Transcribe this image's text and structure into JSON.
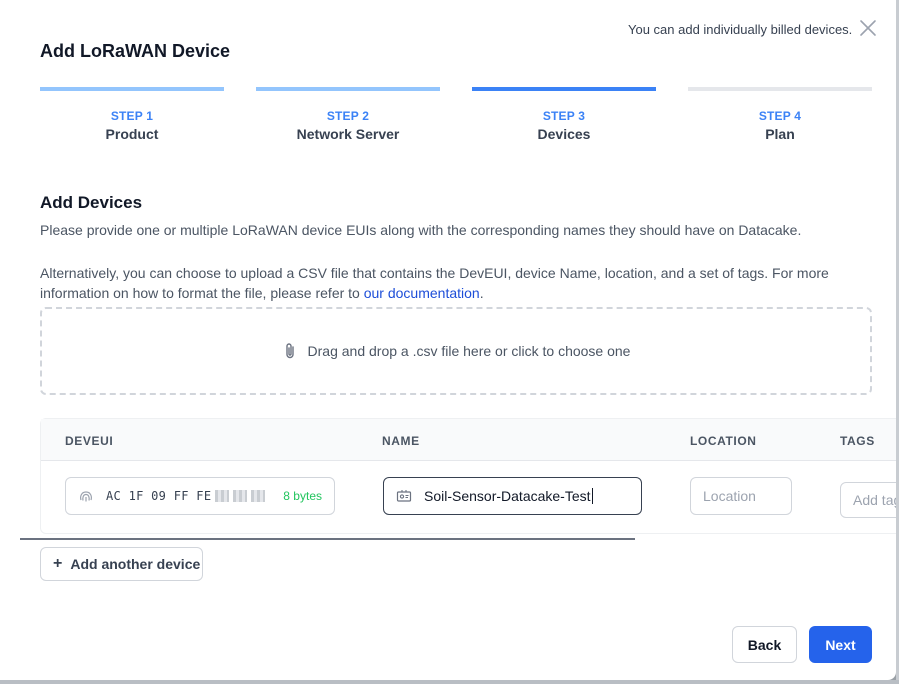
{
  "header": {
    "title": "Add LoRaWAN Device",
    "billing_note": "You can add individually billed devices.",
    "close_icon": "close-icon"
  },
  "steps": [
    {
      "num": "STEP 1",
      "label": "Product",
      "state": "complete"
    },
    {
      "num": "STEP 2",
      "label": "Network Server",
      "state": "complete"
    },
    {
      "num": "STEP 3",
      "label": "Devices",
      "state": "active"
    },
    {
      "num": "STEP 4",
      "label": "Plan",
      "state": "upcoming"
    }
  ],
  "section": {
    "title": "Add Devices",
    "description": "Please provide one or multiple LoRaWAN device EUIs along with the corresponding names they should have on Datacake.",
    "csv_text_before": "Alternatively, you can choose to upload a CSV file that contains the DevEUI, device Name, location, and a set of tags. For more information on how to format the file, please refer to ",
    "csv_link": "our documentation",
    "csv_text_after": "."
  },
  "dropzone": {
    "text": "Drag and drop a .csv file here or click to choose one",
    "icon": "paperclip-icon"
  },
  "table": {
    "columns": [
      "DEVEUI",
      "NAME",
      "LOCATION",
      "TAGS"
    ],
    "row": {
      "deveui_value": "AC 1F 09 FF FE",
      "deveui_bytes": "8 bytes",
      "deveui_icon": "fingerprint-icon",
      "name_value": "Soil-Sensor-Datacake-Test",
      "name_icon": "id-card-icon",
      "location_placeholder": "Location",
      "tags_placeholder": "Add tags"
    }
  },
  "actions": {
    "add_device": "Add another device",
    "back": "Back",
    "next": "Next"
  },
  "colors": {
    "primary": "#2563eb",
    "step_complete": "#93c5fd",
    "step_active": "#3b82f6",
    "step_upcoming": "#e5e7eb",
    "bytes_ok": "#22c55e"
  }
}
